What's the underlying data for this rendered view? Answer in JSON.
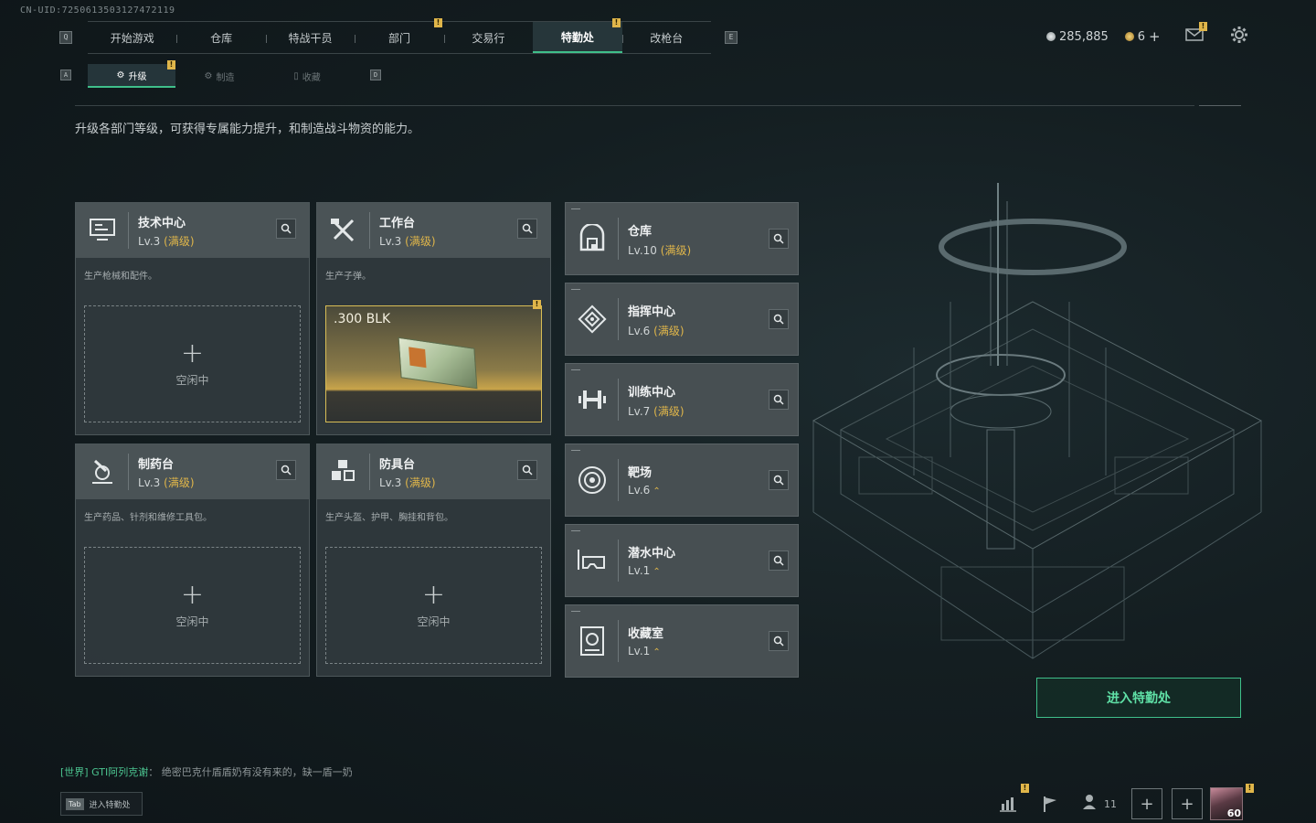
{
  "uid_text": "CN-UID:7250613503127472119",
  "top_nav": {
    "q_key": "Q",
    "e_key": "E",
    "tabs": [
      {
        "label": "开始游戏",
        "active": false,
        "badge": false
      },
      {
        "label": "仓库",
        "active": false,
        "badge": false
      },
      {
        "label": "特战干员",
        "active": false,
        "badge": false
      },
      {
        "label": "部门",
        "active": false,
        "badge": true
      },
      {
        "label": "交易行",
        "active": false,
        "badge": false
      },
      {
        "label": "特勤处",
        "active": true,
        "badge": true
      },
      {
        "label": "改枪台",
        "active": false,
        "badge": false
      }
    ],
    "badge_text": "!"
  },
  "sub_nav": {
    "a_key": "A",
    "d_key": "D",
    "tabs": [
      {
        "label": "升级",
        "icon": "upgrade-icon",
        "active": true
      },
      {
        "label": "制造",
        "icon": "craft-icon",
        "active": false
      },
      {
        "label": "收藏",
        "icon": "collection-icon",
        "active": false
      }
    ]
  },
  "currency": {
    "coins": "285,885",
    "tickets": "6",
    "add": "+"
  },
  "description": "升级各部门等级，可获得专属能力提升，和制造战斗物资的能力。",
  "production_cards": [
    {
      "name": "技术中心",
      "level": "Lv.3",
      "max": "(满级)",
      "desc": "生产枪械和配件。",
      "icon": "tech-center-icon",
      "state": "idle",
      "idle_text": "空闲中"
    },
    {
      "name": "工作台",
      "level": "Lv.3",
      "max": "(满级)",
      "desc": "生产子弹。",
      "icon": "workbench-icon",
      "state": "producing",
      "item": ".300 BLK"
    },
    {
      "name": "制药台",
      "level": "Lv.3",
      "max": "(满级)",
      "desc": "生产药品、针剂和维修工具包。",
      "icon": "pharmacy-icon",
      "state": "idle",
      "idle_text": "空闲中"
    },
    {
      "name": "防具台",
      "level": "Lv.3",
      "max": "(满级)",
      "desc": "生产头盔、护甲、胸挂和背包。",
      "icon": "armor-bench-icon",
      "state": "idle",
      "idle_text": "空闲中"
    }
  ],
  "facilities": [
    {
      "name": "仓库",
      "level": "Lv.10",
      "max": "(满级)",
      "icon": "warehouse-icon",
      "upgradable": false
    },
    {
      "name": "指挥中心",
      "level": "Lv.6",
      "max": "(满级)",
      "icon": "command-center-icon",
      "upgradable": false
    },
    {
      "name": "训练中心",
      "level": "Lv.7",
      "max": "(满级)",
      "icon": "training-center-icon",
      "upgradable": false
    },
    {
      "name": "靶场",
      "level": "Lv.6",
      "max": "",
      "icon": "shooting-range-icon",
      "upgradable": true
    },
    {
      "name": "潜水中心",
      "level": "Lv.1",
      "max": "",
      "icon": "diving-center-icon",
      "upgradable": true
    },
    {
      "name": "收藏室",
      "level": "Lv.1",
      "max": "",
      "icon": "collection-room-icon",
      "upgradable": true
    }
  ],
  "enter_button": "进入特勤处",
  "chat": {
    "channel": "[世界]",
    "sender": "GTI阿列克谢",
    "separator": "：",
    "message": "绝密巴克什盾盾奶有没有来的，缺一盾一奶"
  },
  "tab_hint": {
    "key": "Tab",
    "label": "进入特勤处"
  },
  "bottom_bar": {
    "friends_count": "11",
    "avatar_level": "60"
  },
  "colors": {
    "accent": "#3fbf8a",
    "badge": "#e0b64a",
    "max_level": "#e0b64a"
  }
}
